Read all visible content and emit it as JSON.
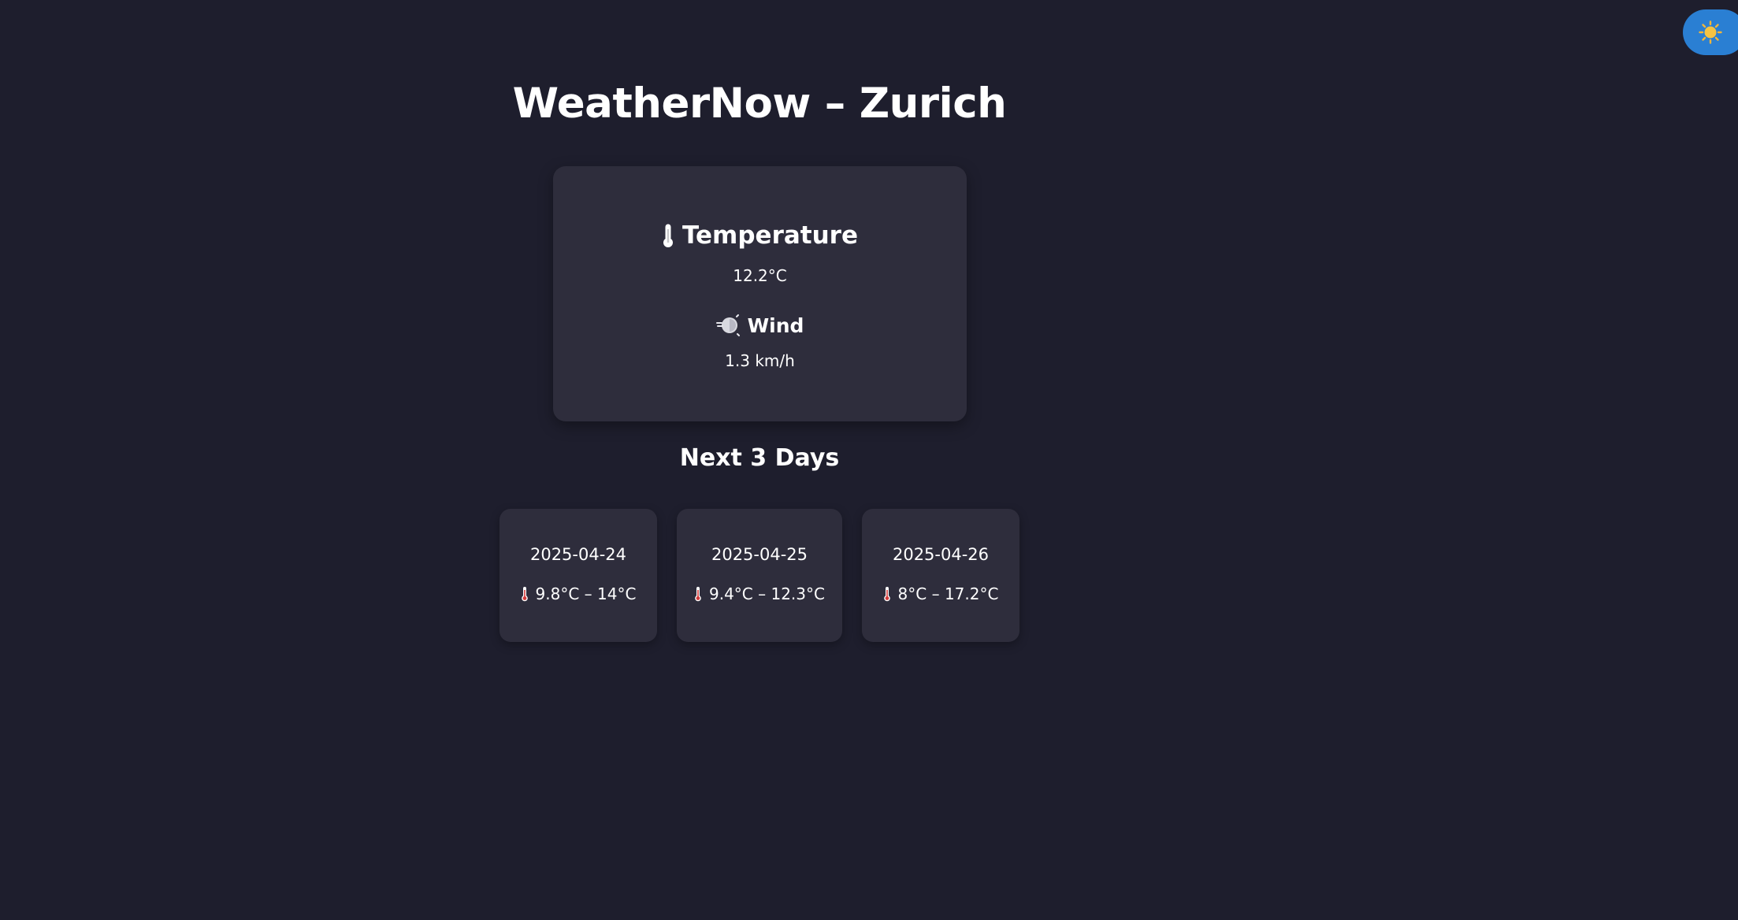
{
  "theme": {
    "background": "#1e1e2d",
    "card": "#2e2d3c",
    "accent": "#2a7fd3",
    "toggle_icon": "sun-icon"
  },
  "page": {
    "title": "WeatherNow – Zurich"
  },
  "current": {
    "temperature_label": "Temperature",
    "temperature_icon": "thermometer-icon",
    "temperature_value": "12.2°C",
    "wind_label": "Wind",
    "wind_icon": "wind-icon",
    "wind_value": "1.3 km/h"
  },
  "forecast": {
    "title": "Next 3 Days",
    "days": [
      {
        "date": "2025-04-24",
        "range": "9.8°C – 14°C"
      },
      {
        "date": "2025-04-25",
        "range": "9.4°C – 12.3°C"
      },
      {
        "date": "2025-04-26",
        "range": "8°C – 17.2°C"
      }
    ]
  }
}
